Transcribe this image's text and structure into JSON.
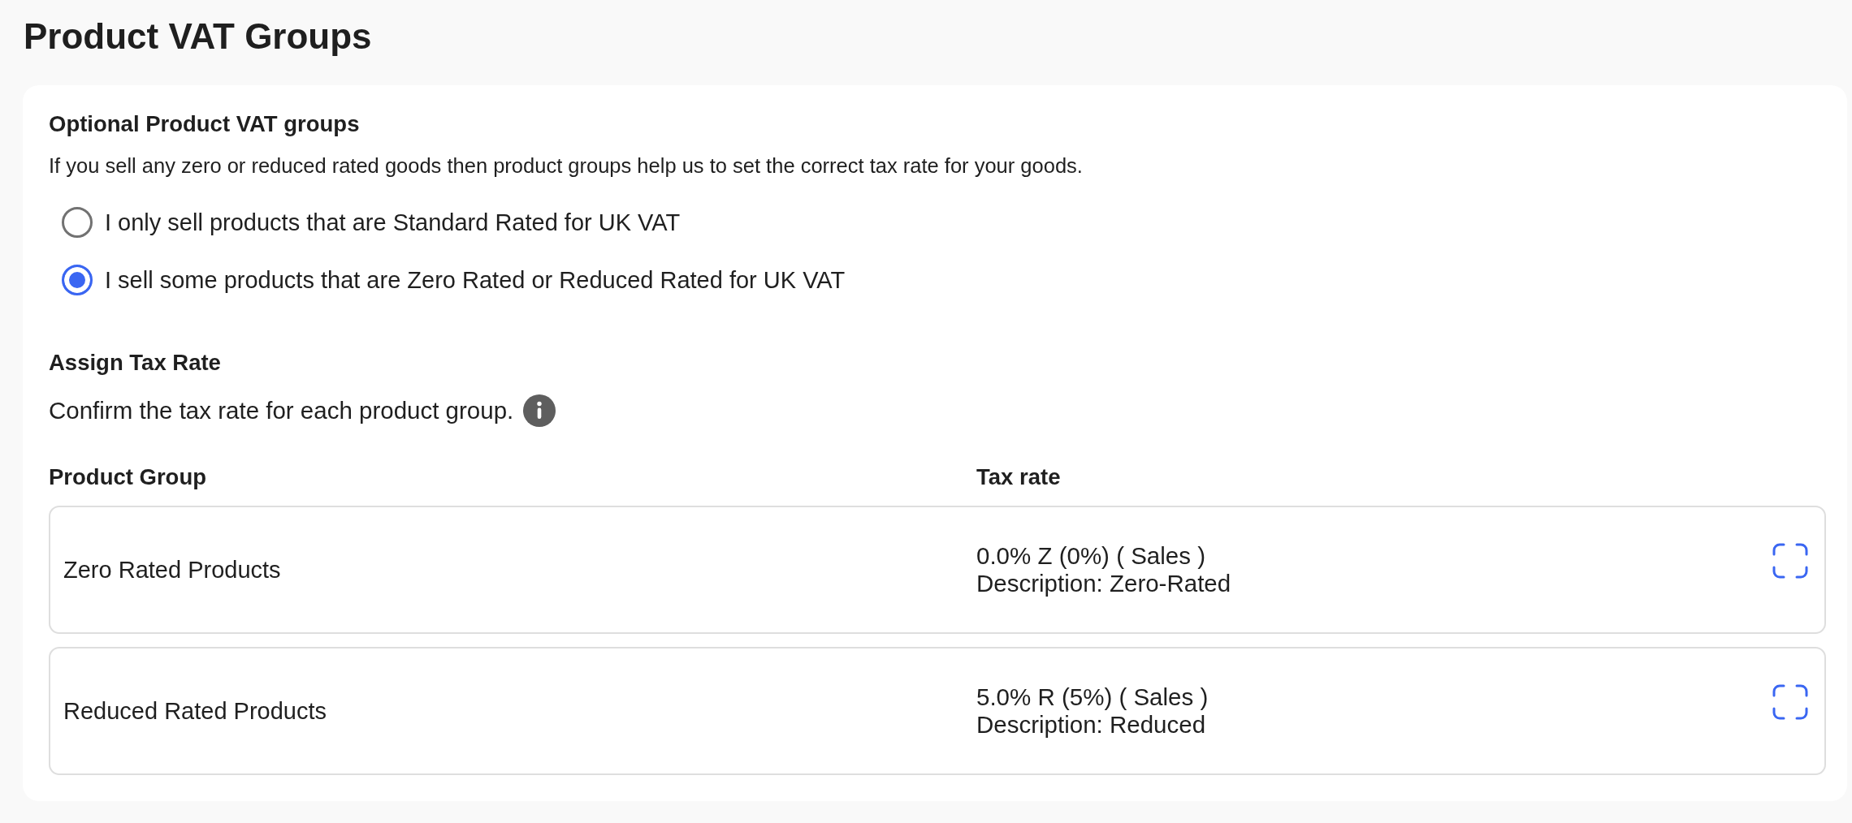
{
  "title": "Product VAT Groups",
  "vat_groups": {
    "heading": "Optional Product VAT groups",
    "description": "If you sell any zero or reduced rated goods then product groups help us to set the correct tax rate for your goods.",
    "options": [
      {
        "label": "I only sell products that are Standard Rated for UK VAT",
        "selected": false
      },
      {
        "label": "I sell some products that are Zero Rated or Reduced Rated for UK VAT",
        "selected": true
      }
    ]
  },
  "tax_rates": {
    "heading": "Assign Tax Rate",
    "instruction": "Confirm the tax rate for each product group.",
    "columns": [
      "Product Group",
      "Tax rate"
    ],
    "rows": [
      {
        "group": "Zero Rated Products",
        "rate": "0.0% Z (0%) ( Sales )",
        "description": "Description: Zero-Rated"
      },
      {
        "group": "Reduced Rated Products",
        "rate": "5.0% R (5%) ( Sales )",
        "description": "Description: Reduced"
      }
    ]
  }
}
